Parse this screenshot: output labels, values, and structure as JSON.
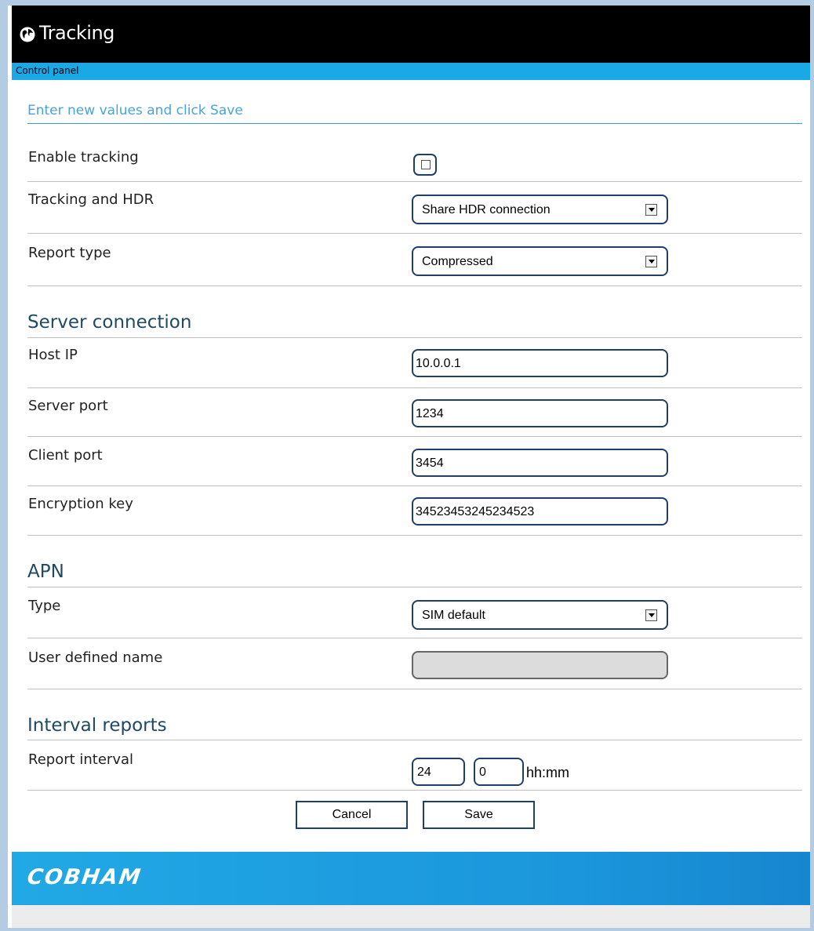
{
  "header": {
    "title": "Tracking",
    "icon": "globe-icon"
  },
  "subbar": {
    "label": "Control panel"
  },
  "intro": "Enter new values and click Save",
  "tracking": {
    "enable_label": "Enable tracking",
    "enable_checked": false,
    "hdr_label": "Tracking and HDR",
    "hdr_value": "Share HDR connection",
    "report_type_label": "Report type",
    "report_type_value": "Compressed"
  },
  "server": {
    "title": "Server connection",
    "host_ip_label": "Host IP",
    "host_ip_value": "10.0.0.1",
    "server_port_label": "Server port",
    "server_port_value": "1234",
    "client_port_label": "Client port",
    "client_port_value": "3454",
    "encryption_key_label": "Encryption key",
    "encryption_key_value": "34523453245234523"
  },
  "apn": {
    "title": "APN",
    "type_label": "Type",
    "type_value": "SIM default",
    "user_name_label": "User defined name",
    "user_name_value": ""
  },
  "interval": {
    "title": "Interval reports",
    "report_interval_label": "Report interval",
    "hours_value": "24",
    "minutes_value": "0",
    "unit": "hh:mm"
  },
  "buttons": {
    "cancel": "Cancel",
    "save": "Save"
  },
  "footer": {
    "brand": "COBHAM"
  },
  "colors": {
    "header_bg": "#000000",
    "accent": "#1ba8e6",
    "section_title": "#1e4a63",
    "intro_text": "#4aa3d9",
    "field_border": "#1e3f66"
  }
}
